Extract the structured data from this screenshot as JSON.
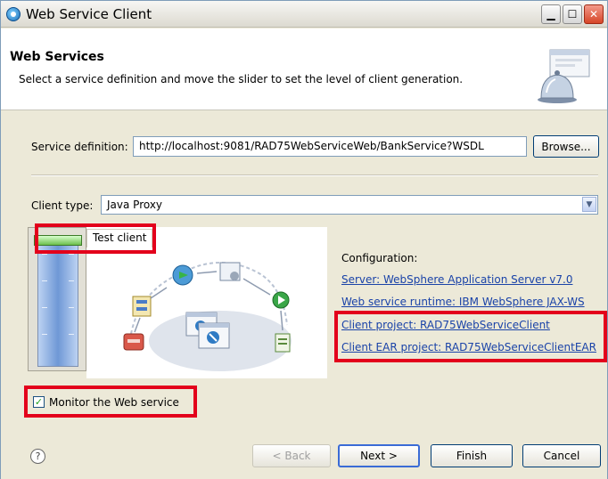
{
  "window": {
    "title": "Web Service Client"
  },
  "header": {
    "title": "Web Services",
    "description": "Select a service definition and move the slider to set the level of client generation."
  },
  "service": {
    "label": "Service definition:",
    "value": "http://localhost:9081/RAD75WebServiceWeb/BankService?WSDL",
    "browse_label": "Browse..."
  },
  "client": {
    "label": "Client type:",
    "value": "Java Proxy"
  },
  "slider": {
    "level_label": "Test client"
  },
  "configuration": {
    "label": "Configuration:",
    "links": [
      "Server: WebSphere Application Server v7.0",
      "Web service runtime: IBM WebSphere JAX-WS",
      "Client project: RAD75WebServiceClient",
      "Client EAR project: RAD75WebServiceClientEAR"
    ]
  },
  "monitor": {
    "label": "Monitor the Web service",
    "checked": true
  },
  "footer": {
    "help_icon": "?",
    "back_label": "< Back",
    "next_label": "Next >",
    "finish_label": "Finish",
    "cancel_label": "Cancel"
  },
  "colors": {
    "highlight": "#e3001b",
    "link": "#1a43a8"
  }
}
